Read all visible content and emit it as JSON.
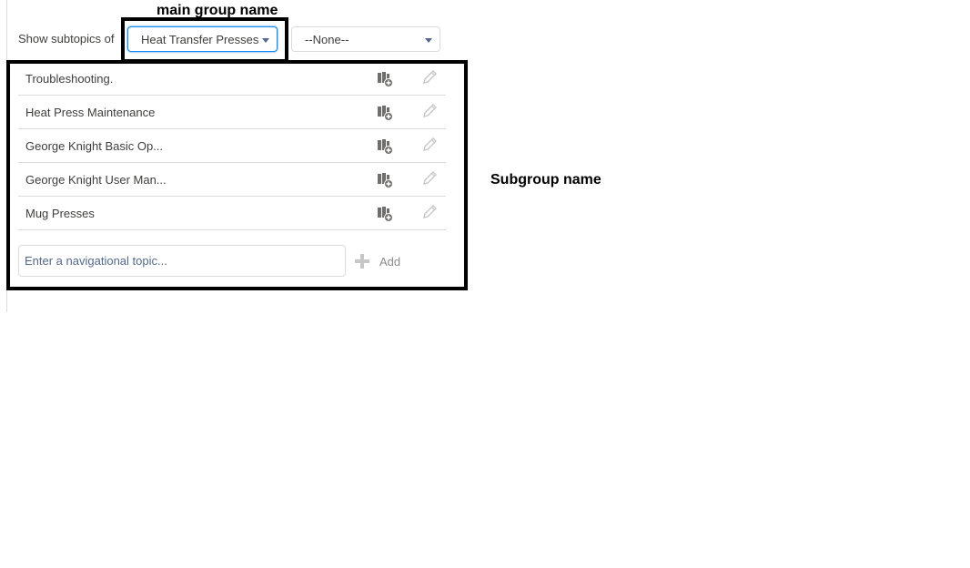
{
  "annotations": {
    "main_group": "main group name",
    "subgroup": "Subgroup name"
  },
  "filter": {
    "label": "Show subtopics of",
    "primary_select": {
      "value": "Heat Transfer Presses"
    },
    "secondary_select": {
      "value": "--None--"
    }
  },
  "topics": [
    {
      "name": "Troubleshooting.",
      "add_icon": "book-add-icon",
      "edit_icon": "pencil-icon"
    },
    {
      "name": "Heat Press Maintenance",
      "add_icon": "book-add-icon",
      "edit_icon": "pencil-icon"
    },
    {
      "name": "George Knight Basic Op...",
      "add_icon": "book-add-icon",
      "edit_icon": "pencil-icon"
    },
    {
      "name": "George Knight User Man...",
      "add_icon": "book-add-icon",
      "edit_icon": "pencil-icon"
    },
    {
      "name": "Mug Presses",
      "add_icon": "book-add-icon",
      "edit_icon": "pencil-icon"
    }
  ],
  "new_topic": {
    "placeholder": "Enter a navigational topic...",
    "value": "",
    "add_label": "Add"
  },
  "colors": {
    "focus_border": "#1589ee",
    "icon_dark": "#706e6b",
    "icon_light": "#c9c7c5",
    "annotation_border": "#000000"
  }
}
